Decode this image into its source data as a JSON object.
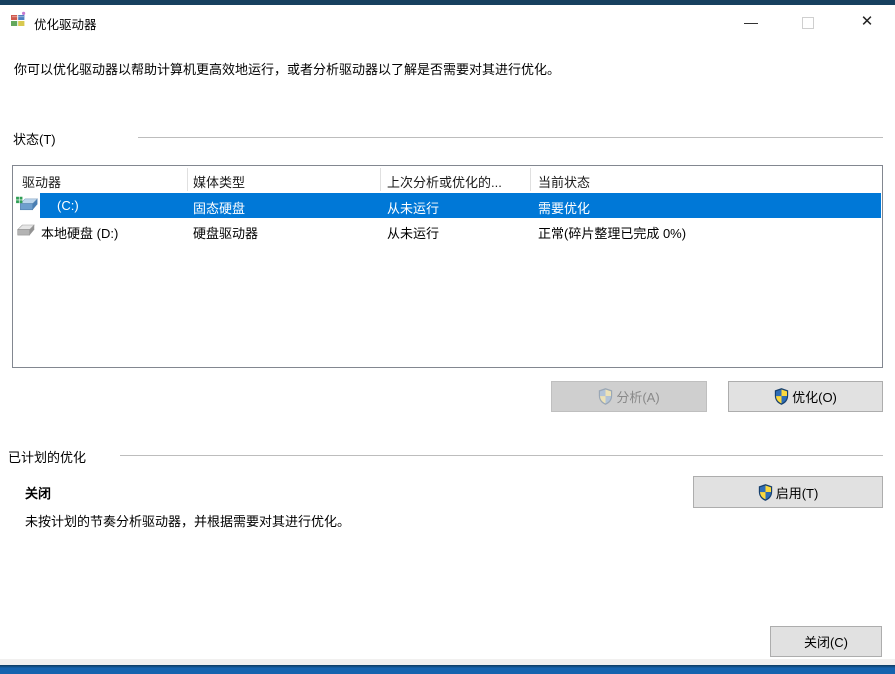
{
  "titlebar": {
    "title": "优化驱动器",
    "minimize_glyph": "—",
    "close_glyph": "✕"
  },
  "description": "你可以优化驱动器以帮助计算机更高效地运行，或者分析驱动器以了解是否需要对其进行优化。",
  "status_section": {
    "label": "状态(T)",
    "table": {
      "columns": [
        "驱动器",
        "媒体类型",
        "上次分析或优化的...",
        "当前状态"
      ],
      "rows": [
        {
          "drive": "(C:)",
          "media_type": "固态硬盘",
          "last_run": "从未运行",
          "status": "需要优化",
          "selected": true,
          "icon": "windows-system-drive-icon"
        },
        {
          "drive": "本地硬盘 (D:)",
          "media_type": "硬盘驱动器",
          "last_run": "从未运行",
          "status": "正常(碎片整理已完成 0%)",
          "selected": false,
          "icon": "hard-drive-icon"
        }
      ]
    },
    "analyze_button_label": "分析(A)",
    "optimize_button_label": "优化(O)"
  },
  "scheduled_section": {
    "label": "已计划的优化",
    "state_label": "关闭",
    "state_description": "未按计划的节奏分析驱动器，并根据需要对其进行优化。",
    "enable_button_label": "启用(T)"
  },
  "footer": {
    "close_button_label": "关闭(C)"
  },
  "colors": {
    "selection": "#0078d7",
    "top_edge": "#17405f",
    "bottom_edge": "#1563ae",
    "shield_blue": "#2f6db6",
    "shield_yellow": "#fbd93d",
    "button_face": "#e1e1e1",
    "button_border": "#adadad"
  }
}
